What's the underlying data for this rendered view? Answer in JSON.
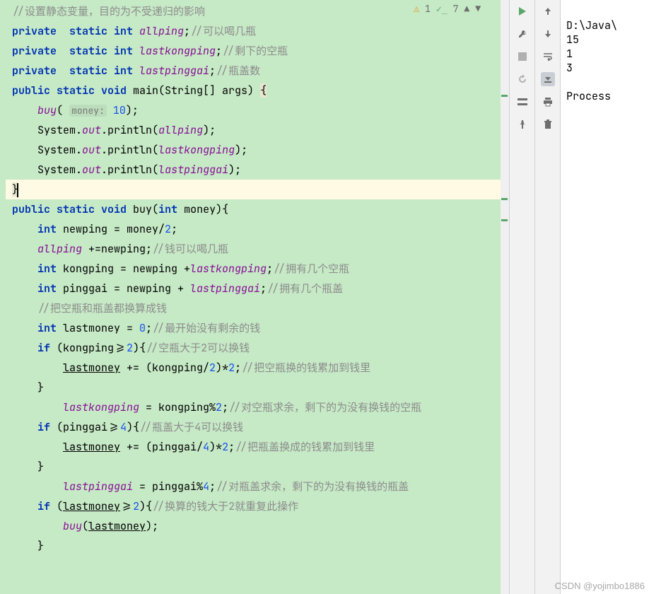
{
  "analysis": {
    "warnings": "1",
    "ok": "7"
  },
  "code": {
    "l1_cmt": "//设置静态变量，目的为不受递归的影响",
    "l2_a": "private  static int ",
    "l2_b": "allping",
    "l2_c": ";",
    "l2_cmt": "//可以喝几瓶",
    "l3_a": "private  static int ",
    "l3_b": "lastkongping",
    "l3_c": ";",
    "l3_cmt": "//剩下的空瓶",
    "l4_a": "private  static int ",
    "l4_b": "lastpinggai",
    "l4_c": ";",
    "l4_cmt": "//瓶盖数",
    "l5_a": "public static void ",
    "l5_b": "main",
    "l5_c": "(String[] args) ",
    "l5_d": "{",
    "l6_a": "buy",
    "l6_b": "(",
    "l6_hint": "money:",
    "l6_num": "10",
    "l6_c": ");",
    "l7_a": "System.",
    "l7_b": "out",
    "l7_c": ".println(",
    "l7_d": "allping",
    "l7_e": ");",
    "l8_a": "System.",
    "l8_b": "out",
    "l8_c": ".println(",
    "l8_d": "lastkongping",
    "l8_e": ");",
    "l9_a": "System.",
    "l9_b": "out",
    "l9_c": ".println(",
    "l9_d": "lastpinggai",
    "l9_e": ");",
    "l10": "}",
    "l11_a": "public static void ",
    "l11_b": "buy",
    "l11_c": "(",
    "l11_d": "int ",
    "l11_e": "money",
    "l11_f": "){",
    "l12_a": "int ",
    "l12_b": "newping = money/",
    "l12_num": "2",
    "l12_c": ";",
    "l13_a": "allping",
    "l13_b": " +=newping;",
    "l13_cmt": "//钱可以喝几瓶",
    "l14_a": "int ",
    "l14_b": "kongping = newping +",
    "l14_c": "lastkongping",
    "l14_d": ";",
    "l14_cmt": "//拥有几个空瓶",
    "l15_a": "int ",
    "l15_b": "pinggai = newping + ",
    "l15_c": "lastpinggai",
    "l15_d": ";",
    "l15_cmt": "//拥有几个瓶盖",
    "l16_cmt": "//把空瓶和瓶盖都换算成钱",
    "l17_a": "int ",
    "l17_b": "lastmoney = ",
    "l17_num": "0",
    "l17_c": ";",
    "l17_cmt": "//最开始没有剩余的钱",
    "l18_a": "if ",
    "l18_b": "(kongping>=",
    "l18_num": "2",
    "l18_c": "){",
    "l18_cmt": "//空瓶大于2可以换钱",
    "l19_a": "lastmoney",
    "l19_b": " += (kongping/",
    "l19_n1": "2",
    "l19_c": ")*",
    "l19_n2": "2",
    "l19_d": ";",
    "l19_cmt": "//把空瓶换的钱累加到钱里",
    "l20": "}",
    "l21_a": "lastkongping",
    "l21_b": " = kongping%",
    "l21_num": "2",
    "l21_c": ";",
    "l21_cmt": "//对空瓶求余，剩下的为没有换钱的空瓶",
    "l22_a": "if ",
    "l22_b": "(pinggai>=",
    "l22_num": "4",
    "l22_c": "){",
    "l22_cmt": "//瓶盖大于4可以换钱",
    "l23_a": "lastmoney",
    "l23_b": " += (pinggai/",
    "l23_n1": "4",
    "l23_c": ")*",
    "l23_n2": "2",
    "l23_d": ";",
    "l23_cmt": "//把瓶盖换成的钱累加到钱里",
    "l24": "}",
    "l25_a": "lastpinggai",
    "l25_b": " = pinggai%",
    "l25_num": "4",
    "l25_c": ";",
    "l25_cmt": "//对瓶盖求余，剩下的为没有换钱的瓶盖",
    "l26_a": "if ",
    "l26_b": "(",
    "l26_c": "lastmoney",
    "l26_d": ">=",
    "l26_num": "2",
    "l26_e": "){",
    "l26_cmt": "//换算的钱大于2就重复此操作",
    "l27_a": "buy",
    "l27_b": "(",
    "l27_c": "lastmoney",
    "l27_d": ");",
    "l28": "}"
  },
  "console": {
    "path": "D:\\Java\\",
    "out1": "15",
    "out2": "1",
    "out3": "3",
    "proc": "Process "
  },
  "watermark": "CSDN @yojimbo1886"
}
